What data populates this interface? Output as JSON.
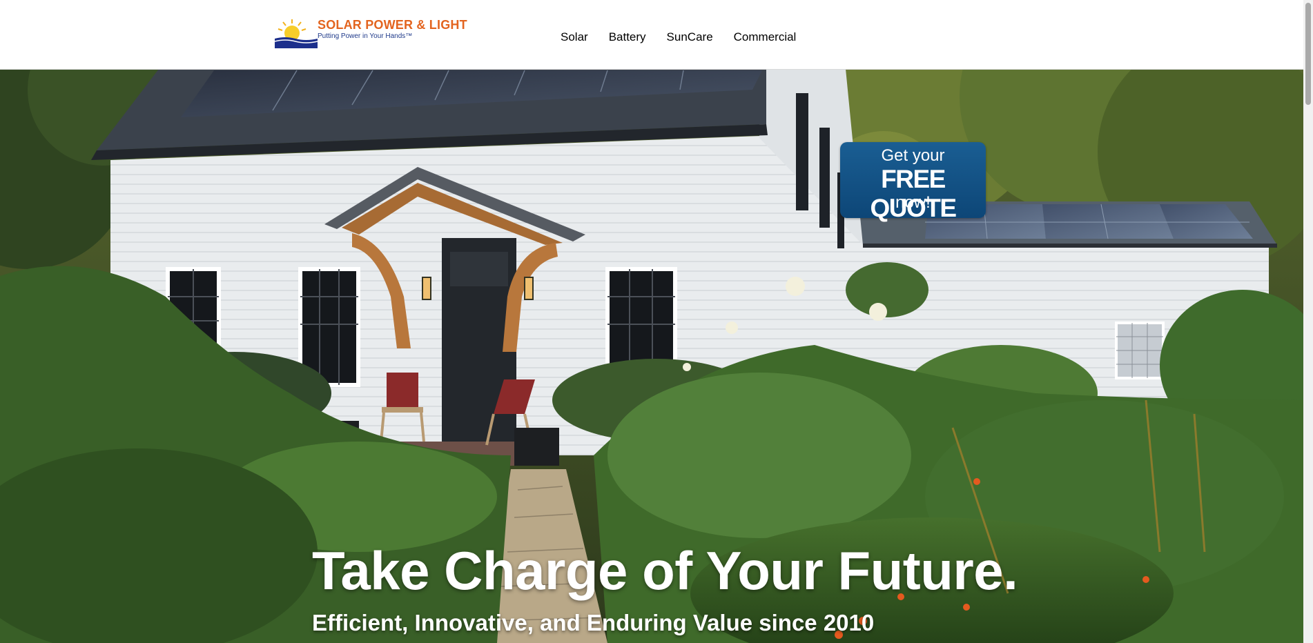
{
  "header": {
    "brand_name": "SOLAR POWER & LIGHT",
    "tagline": "Putting Power in Your Hands™",
    "nav": [
      {
        "label": "Solar"
      },
      {
        "label": "Battery"
      },
      {
        "label": "SunCare"
      },
      {
        "label": "Commercial"
      }
    ]
  },
  "hero": {
    "cta": {
      "line1": "Get your",
      "line2": "FREE QUOTE",
      "line3": "now!"
    },
    "headline": "Take Charge of Your Future.",
    "subheadline": "Efficient, Innovative, and Enduring Value since 2010"
  },
  "colors": {
    "brand_orange": "#e3641f",
    "brand_navy": "#1f3a8a",
    "cta_blue": "#135588",
    "house_white": "#e9ecee"
  },
  "icons": {
    "logo": "sun-over-water-logo-icon"
  }
}
